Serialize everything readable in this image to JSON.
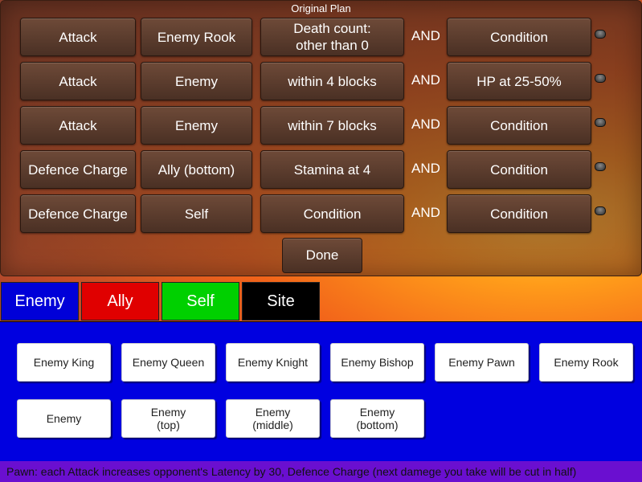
{
  "plan": {
    "title": "Original Plan",
    "and_label": "AND",
    "rows": [
      {
        "action": "Attack",
        "target": "Enemy Rook",
        "condition1": "Death count:\nother than 0",
        "condition2": "Condition"
      },
      {
        "action": "Attack",
        "target": "Enemy",
        "condition1": "within 4 blocks",
        "condition2": "HP at 25-50%"
      },
      {
        "action": "Attack",
        "target": "Enemy",
        "condition1": "within 7 blocks",
        "condition2": "Condition"
      },
      {
        "action": "Defence Charge",
        "target": "Ally (bottom)",
        "condition1": "Stamina at 4",
        "condition2": "Condition"
      },
      {
        "action": "Defence Charge",
        "target": "Self",
        "condition1": "Condition",
        "condition2": "Condition"
      }
    ],
    "done_label": "Done"
  },
  "tabs": [
    {
      "label": "Enemy",
      "color": "#0000d8"
    },
    {
      "label": "Ally",
      "color": "#e00000"
    },
    {
      "label": "Self",
      "color": "#00d000"
    },
    {
      "label": "Site",
      "color": "#000000"
    }
  ],
  "targets": [
    "Enemy King",
    "Enemy Queen",
    "Enemy Knight",
    "Enemy Bishop",
    "Enemy Pawn",
    "Enemy Rook",
    "Enemy",
    "Enemy\n(top)",
    "Enemy\n(middle)",
    "Enemy\n(bottom)"
  ],
  "status": "Pawn: each Attack increases opponent's Latency by 30, Defence Charge (next damege you take will be cut in half)"
}
